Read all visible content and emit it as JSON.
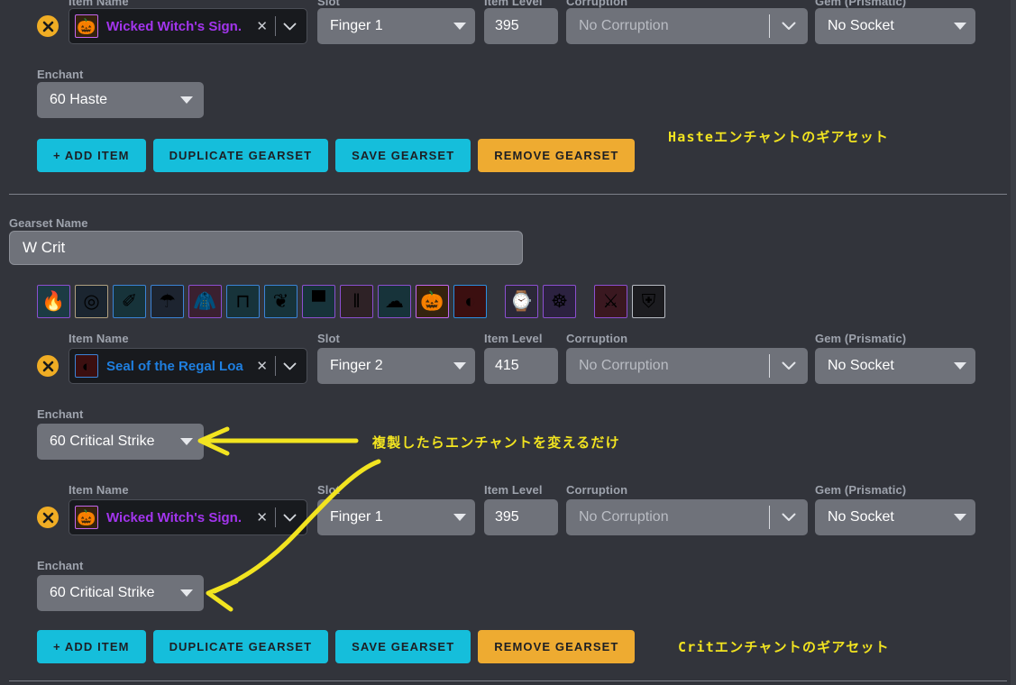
{
  "columns": {
    "item_name": "Item Name",
    "slot": "Slot",
    "item_level": "Item Level",
    "corruption": "Corruption",
    "gem": "Gem (Prismatic)",
    "enchant": "Enchant",
    "gearset_name": "Gearset Name"
  },
  "gearset_haste": {
    "items": [
      {
        "name": "Wicked Witch's Sign.",
        "quality": "epic",
        "icon": "pumpkin-item-icon",
        "slot": "Finger 1",
        "item_level": "395",
        "corruption": "No Corruption",
        "gem": "No Socket",
        "enchant": "60 Haste"
      }
    ],
    "buttons": {
      "add_item": "+ ADD ITEM",
      "duplicate": "DUPLICATE GEARSET",
      "save": "SAVE GEARSET",
      "remove": "REMOVE GEARSET"
    }
  },
  "gearset_crit": {
    "name_value": "W Crit",
    "equipment": [
      {
        "glyph": "🔥",
        "border": "#8c4fd0",
        "bg": "#1c3b44",
        "name": "equip-icon-head"
      },
      {
        "glyph": "◎",
        "border": "#b0a080",
        "bg": "#1b2530",
        "name": "equip-icon-neck"
      },
      {
        "glyph": "✐",
        "border": "#3b83d6",
        "bg": "#17333a",
        "name": "equip-icon-shoulder"
      },
      {
        "glyph": "☂",
        "border": "#3b83d6",
        "bg": "#1d2430",
        "name": "equip-icon-back"
      },
      {
        "glyph": "🧥",
        "border": "#8c4fd0",
        "bg": "#3a2030",
        "name": "equip-icon-chest"
      },
      {
        "glyph": "⊓",
        "border": "#3b83d6",
        "bg": "#17333a",
        "name": "equip-icon-waist"
      },
      {
        "glyph": "❦",
        "border": "#3b83d6",
        "bg": "#17333a",
        "name": "equip-icon-wrist"
      },
      {
        "glyph": "▀",
        "border": "#8c4fd0",
        "bg": "#17333a",
        "name": "equip-icon-hands"
      },
      {
        "glyph": "‖",
        "border": "#8c4fd0",
        "bg": "#2e2226",
        "name": "equip-icon-legs"
      },
      {
        "glyph": "☁",
        "border": "#8c4fd0",
        "bg": "#17333a",
        "name": "equip-icon-feet"
      },
      {
        "glyph": "🎃",
        "border": "#c266ee",
        "bg": "#35230f",
        "name": "equip-icon-finger1"
      },
      {
        "glyph": "◐",
        "border": "#2a8fe0",
        "bg": "#3b0f10",
        "name": "equip-icon-finger2"
      },
      {
        "gap": true
      },
      {
        "glyph": "⌚",
        "border": "#8c4fd0",
        "bg": "#2b2838",
        "name": "equip-icon-trinket1"
      },
      {
        "glyph": "☸",
        "border": "#8c4fd0",
        "bg": "#2c2240",
        "name": "equip-icon-trinket2"
      },
      {
        "gap": true
      },
      {
        "glyph": "⚔",
        "border": "#8c4fd0",
        "bg": "#3a1820",
        "name": "equip-icon-mainhand"
      },
      {
        "glyph": "⛨",
        "border": "#b8bcc4",
        "bg": "#1c1c20",
        "name": "equip-icon-offhand"
      }
    ],
    "items": [
      {
        "name": "Seal of the Regal Loa",
        "quality": "rare",
        "icon": "ring-item-icon",
        "slot": "Finger 2",
        "item_level": "415",
        "corruption": "No Corruption",
        "gem": "No Socket",
        "enchant": "60 Critical Strike"
      },
      {
        "name": "Wicked Witch's Sign.",
        "quality": "epic",
        "icon": "pumpkin-item-icon",
        "slot": "Finger 1",
        "item_level": "395",
        "corruption": "No Corruption",
        "gem": "No Socket",
        "enchant": "60 Critical Strike"
      }
    ],
    "buttons": {
      "add_item": "+ ADD ITEM",
      "duplicate": "DUPLICATE GEARSET",
      "save": "SAVE GEARSET",
      "remove": "REMOVE GEARSET"
    }
  },
  "annotations": {
    "haste_note": "Hasteエンチャントのギアセット",
    "duplicate_note": "複製したらエンチャントを変えるだけ",
    "crit_note": "Critエンチャントのギアセット"
  },
  "colors": {
    "accent_cyan": "#15bedb",
    "accent_amber": "#eeab31",
    "annotation_yellow": "#f2e420",
    "epic_purple": "#a335ee",
    "rare_blue": "#1f7fe0",
    "page_bg": "#32343b"
  }
}
